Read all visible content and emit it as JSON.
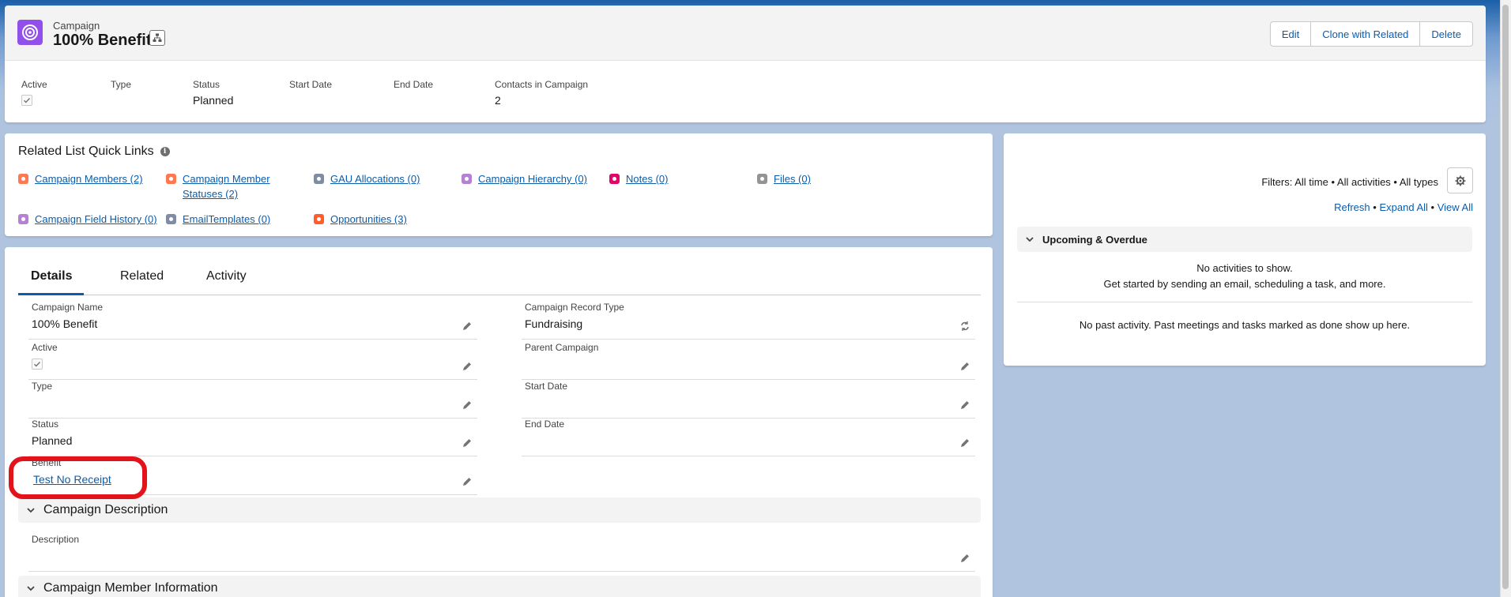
{
  "header": {
    "object_label": "Campaign",
    "record_title": "100% Benefit",
    "buttons": {
      "edit": "Edit",
      "clone": "Clone with Related",
      "delete": "Delete"
    },
    "highlights": [
      {
        "label": "Active",
        "value": ""
      },
      {
        "label": "Type",
        "value": ""
      },
      {
        "label": "Status",
        "value": "Planned"
      },
      {
        "label": "Start Date",
        "value": ""
      },
      {
        "label": "End Date",
        "value": ""
      },
      {
        "label": "Contacts in Campaign",
        "value": "2"
      }
    ]
  },
  "quick_links": {
    "title": "Related List Quick Links",
    "items": [
      {
        "label": "Campaign Members (2)",
        "icon": "campaign-members-icon",
        "color": "#ff784f"
      },
      {
        "label": "Campaign Member",
        "label2": "Statuses (2)",
        "icon": "campaign-member-statuses-icon",
        "color": "#ff784f"
      },
      {
        "label": "GAU Allocations (0)",
        "icon": "wrench-icon",
        "color": "#7f8ca3"
      },
      {
        "label": "Campaign Hierarchy (0)",
        "icon": "campaign-hierarchy-icon",
        "color": "#b781d3"
      },
      {
        "label": "Notes (0)",
        "icon": "notes-icon",
        "color": "#e3066a"
      },
      {
        "label": "Files (0)",
        "icon": "files-icon",
        "color": "#969492"
      },
      {
        "label": "Campaign Field History (0)",
        "icon": "field-history-icon",
        "color": "#b781d3"
      },
      {
        "label": "EmailTemplates (0)",
        "icon": "wrench-icon",
        "color": "#7f8ca3"
      },
      {
        "label": "Opportunities (3)",
        "icon": "crown-icon",
        "color": "#ff5d2d"
      }
    ]
  },
  "tabs": [
    "Details",
    "Related",
    "Activity"
  ],
  "details": {
    "fields": [
      {
        "label": "Campaign Name",
        "value": "100% Benefit"
      },
      {
        "label": "Campaign Record Type",
        "value": "Fundraising"
      },
      {
        "label": "Active",
        "value": ""
      },
      {
        "label": "Parent Campaign",
        "value": ""
      },
      {
        "label": "Type",
        "value": ""
      },
      {
        "label": "Start Date",
        "value": ""
      },
      {
        "label": "Status",
        "value": "Planned"
      },
      {
        "label": "End Date",
        "value": ""
      },
      {
        "label": "Benefit",
        "value": "Test No Receipt"
      }
    ],
    "sections": [
      "Campaign Description",
      "Campaign Member Information"
    ],
    "description": {
      "label": "Description",
      "value": ""
    }
  },
  "activity": {
    "filters": "Filters: All time • All activities • All types",
    "refresh": "Refresh",
    "expand_all": "Expand All",
    "view_all": "View All",
    "separator": "•",
    "upcoming_title": "Upcoming & Overdue",
    "no_activities": "No activities to show.",
    "get_started": "Get started by sending an email, scheduling a task, and more.",
    "no_past": "No past activity. Past meetings and tasks marked as done show up here."
  },
  "colors": {
    "brand": "#0b5cab",
    "campaign_icon": "#9050e9",
    "highlight": "#e2131b"
  }
}
